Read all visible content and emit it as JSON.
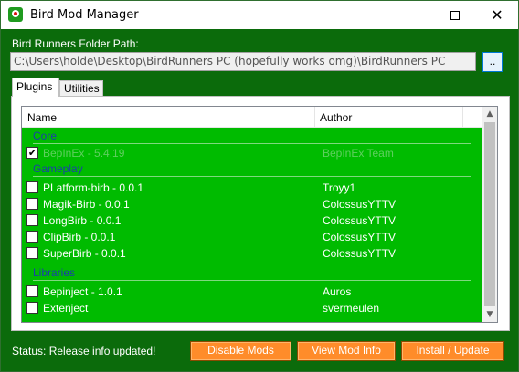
{
  "window": {
    "title": "Bird Mod Manager"
  },
  "folder": {
    "label": "Bird Runners Folder Path:",
    "value": "C:\\Users\\holde\\Desktop\\BirdRunners PC (hopefully works omg)\\BirdRunners PC",
    "browse_label": ".."
  },
  "tabs": [
    {
      "label": "Plugins",
      "selected": true
    },
    {
      "label": "Utilities",
      "selected": false
    }
  ],
  "list": {
    "columns": [
      "Name",
      "Author"
    ],
    "groups": [
      {
        "label": "Core",
        "items": [
          {
            "name": "BepInEx - 5.4.19",
            "author": "BepInEx Team",
            "checked": true,
            "disabled": true
          }
        ]
      },
      {
        "label": "Gameplay",
        "items": [
          {
            "name": "PLatform-birb - 0.0.1",
            "author": "Troyy1",
            "checked": false
          },
          {
            "name": "Magik-Birb - 0.0.1",
            "author": "ColossusYTTV",
            "checked": false
          },
          {
            "name": "LongBirb - 0.0.1",
            "author": "ColossusYTTV",
            "checked": false
          },
          {
            "name": "ClipBirb - 0.0.1",
            "author": "ColossusYTTV",
            "checked": false
          },
          {
            "name": "SuperBirb - 0.0.1",
            "author": "ColossusYTTV",
            "checked": false
          }
        ]
      },
      {
        "label": "Libraries",
        "items": [
          {
            "name": "Bepinject - 1.0.1",
            "author": "Auros",
            "checked": false
          },
          {
            "name": "Extenject",
            "author": "svermeulen",
            "checked": false
          }
        ]
      }
    ]
  },
  "status": "Status: Release info updated!",
  "buttons": {
    "disable_mods": "Disable Mods",
    "view_mod_info": "View Mod Info",
    "install_update": "Install / Update"
  },
  "colors": {
    "window_bg": "#0b6b0b",
    "list_bg": "#00bb00",
    "accent_button": "#ff8c2a",
    "group_label": "#1a3fa8"
  },
  "icons": {
    "app": "bird-icon",
    "checkbox_checked": "✔",
    "scroll_up": "▲",
    "scroll_down": "▼",
    "close": "✕"
  }
}
